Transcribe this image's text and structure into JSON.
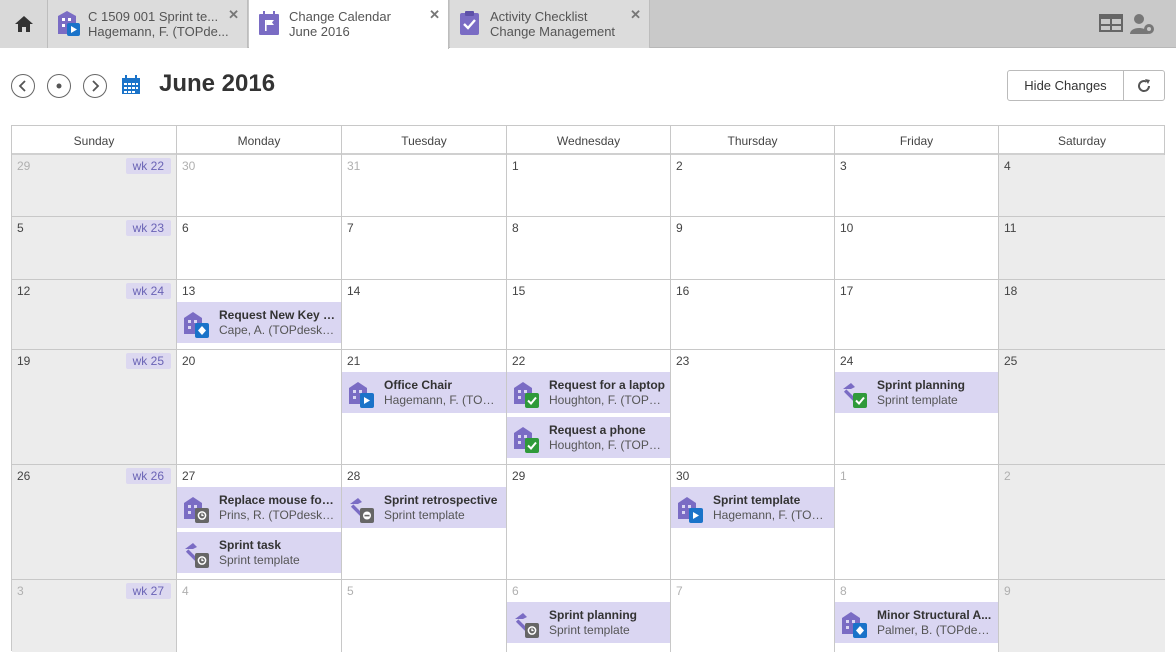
{
  "tabs": [
    {
      "line1": "C 1509 001 Sprint te...",
      "line2": "Hagemann, F. (TOPde...",
      "icon": "building-play-icon"
    },
    {
      "line1": "Change Calendar",
      "line2": "June 2016",
      "icon": "calendar-flag-icon"
    },
    {
      "line1": "Activity Checklist",
      "line2": "Change Management",
      "icon": "clipboard-check-icon"
    }
  ],
  "header": {
    "month_title": "June 2016",
    "hide_changes_label": "Hide Changes"
  },
  "weekdays": [
    "Sunday",
    "Monday",
    "Tuesday",
    "Wednesday",
    "Thursday",
    "Friday",
    "Saturday"
  ],
  "weeks": [
    {
      "wk": "wk 22",
      "days": [
        "29",
        "30",
        "31",
        "1",
        "2",
        "3",
        "4"
      ]
    },
    {
      "wk": "wk 23",
      "days": [
        "5",
        "6",
        "7",
        "8",
        "9",
        "10",
        "11"
      ]
    },
    {
      "wk": "wk 24",
      "days": [
        "12",
        "13",
        "14",
        "15",
        "16",
        "17",
        "18"
      ]
    },
    {
      "wk": "wk 25",
      "days": [
        "19",
        "20",
        "21",
        "22",
        "23",
        "24",
        "25"
      ]
    },
    {
      "wk": "wk 26",
      "days": [
        "26",
        "27",
        "28",
        "29",
        "30",
        "1",
        "2"
      ]
    },
    {
      "wk": "wk 27",
      "days": [
        "3",
        "4",
        "5",
        "6",
        "7",
        "8",
        "9"
      ]
    }
  ],
  "events": [
    {
      "week": 2,
      "day": 1,
      "slot": 0,
      "title": "Request New Key C...",
      "subtitle": "Cape, A. (TOPdesk U...",
      "icon": "building-diamond-icon",
      "badge": "diamond"
    },
    {
      "week": 3,
      "day": 2,
      "slot": 0,
      "title": "Office Chair",
      "subtitle": "Hagemann, F. (TOPd...",
      "icon": "building-play-icon",
      "badge": "play"
    },
    {
      "week": 3,
      "day": 3,
      "slot": 0,
      "title": "Request for a laptop",
      "subtitle": "Houghton, F. (TOPde...",
      "icon": "building-check-icon",
      "badge": "check"
    },
    {
      "week": 3,
      "day": 3,
      "slot": 1,
      "title": "Request a phone",
      "subtitle": "Houghton, F. (TOPde...",
      "icon": "building-check-icon",
      "badge": "check"
    },
    {
      "week": 3,
      "day": 5,
      "slot": 0,
      "title": "Sprint planning",
      "subtitle": "Sprint template",
      "icon": "hammer-check-icon",
      "badge": "check"
    },
    {
      "week": 4,
      "day": 1,
      "slot": 0,
      "title": "Replace mouse for ...",
      "subtitle": "Prins, R. (TOPdesk U...",
      "icon": "building-clock-icon",
      "badge": "clock"
    },
    {
      "week": 4,
      "day": 1,
      "slot": 1,
      "title": "Sprint task",
      "subtitle": "Sprint template",
      "icon": "hammer-clock-icon",
      "badge": "clock"
    },
    {
      "week": 4,
      "day": 2,
      "slot": 0,
      "title": "Sprint retrospective",
      "subtitle": "Sprint template",
      "icon": "hammer-stop-icon",
      "badge": "stop"
    },
    {
      "week": 4,
      "day": 4,
      "slot": 0,
      "title": "Sprint template",
      "subtitle": "Hagemann, F. (TOPd...",
      "icon": "building-play-icon",
      "badge": "play"
    },
    {
      "week": 5,
      "day": 3,
      "slot": 0,
      "title": "Sprint planning",
      "subtitle": "Sprint template",
      "icon": "hammer-clock-icon",
      "badge": "clock"
    },
    {
      "week": 5,
      "day": 5,
      "slot": 0,
      "title": "Minor Structural A...",
      "subtitle": "Palmer, B. (TOPdesk ...",
      "icon": "building-diamond-icon",
      "badge": "diamond"
    }
  ],
  "colors": {
    "event_bg": "#dad6f2",
    "accent": "#7a6cc4",
    "badge_blue": "#1a73c9",
    "badge_green": "#2f9a3a",
    "badge_gray": "#666666"
  }
}
